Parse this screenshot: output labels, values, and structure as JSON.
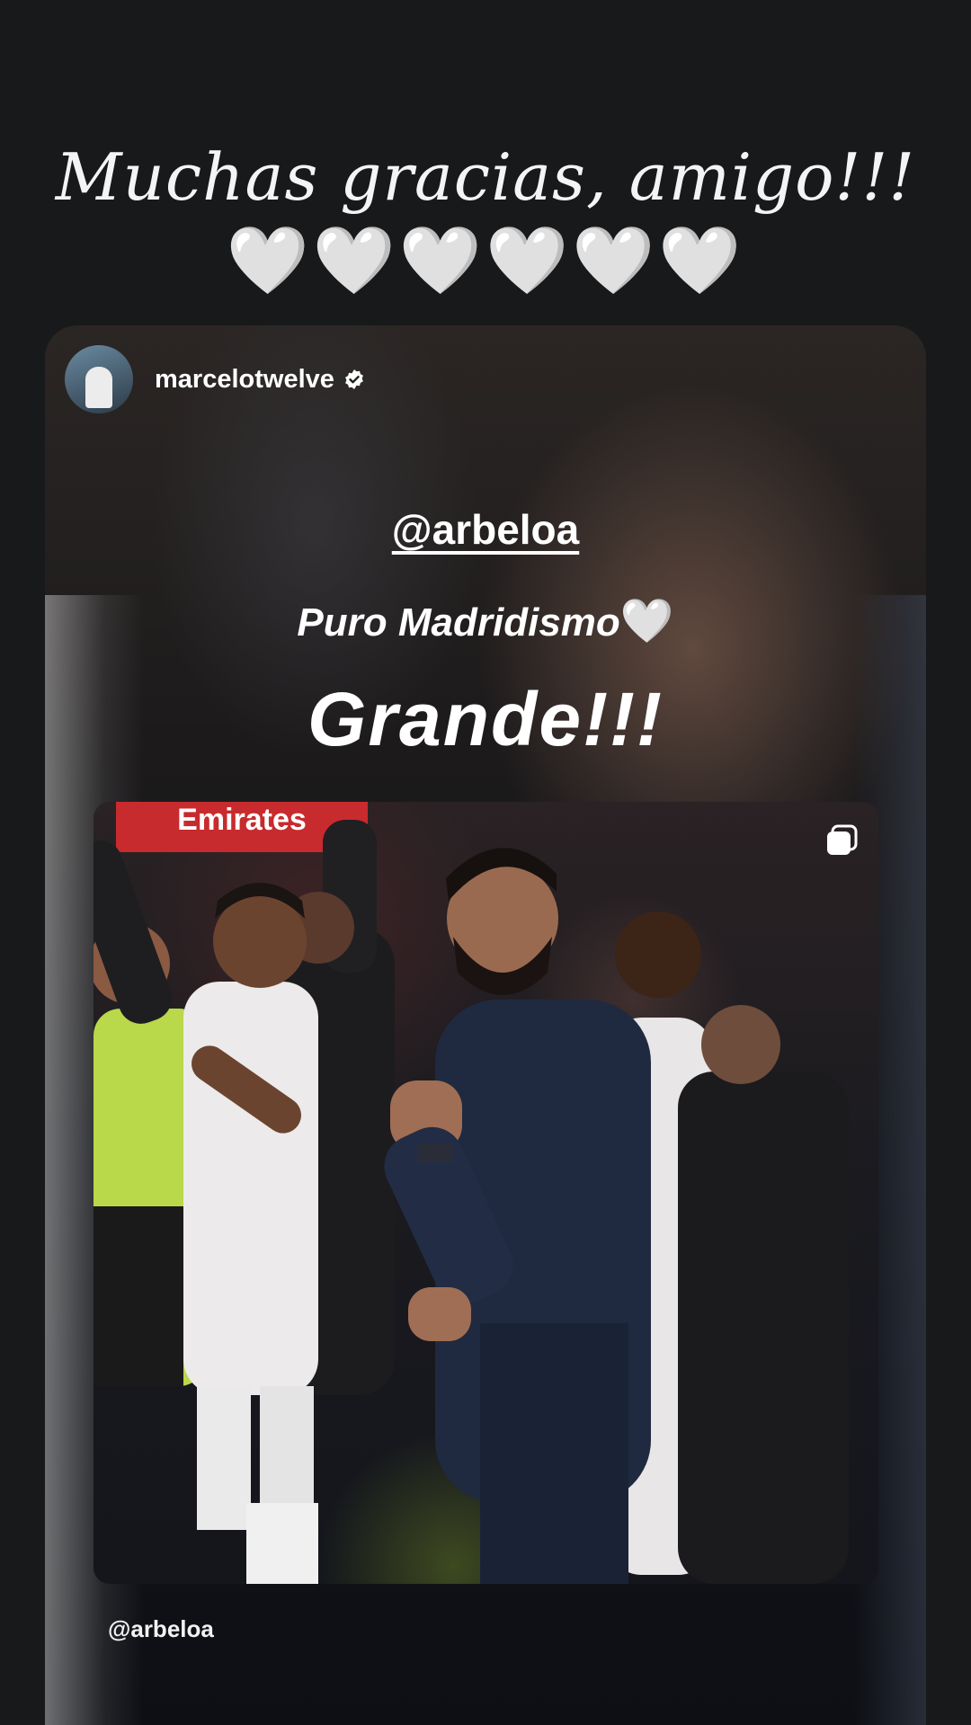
{
  "story": {
    "header_text": "Muchas gracias, amigo!!!",
    "hearts": "🤍🤍🤍🤍🤍🤍"
  },
  "shared_post": {
    "author": {
      "username": "marcelotwelve",
      "verified": true
    },
    "mention_top": "@arbeloa",
    "caption_text": "Puro Madridismo",
    "caption_emoji": "🤍",
    "headline": "Grande!!!",
    "photo": {
      "sponsor_board_text": "Emirates",
      "multi_image_icon": "carousel-icon"
    },
    "mention_bottom": "@arbeloa"
  }
}
